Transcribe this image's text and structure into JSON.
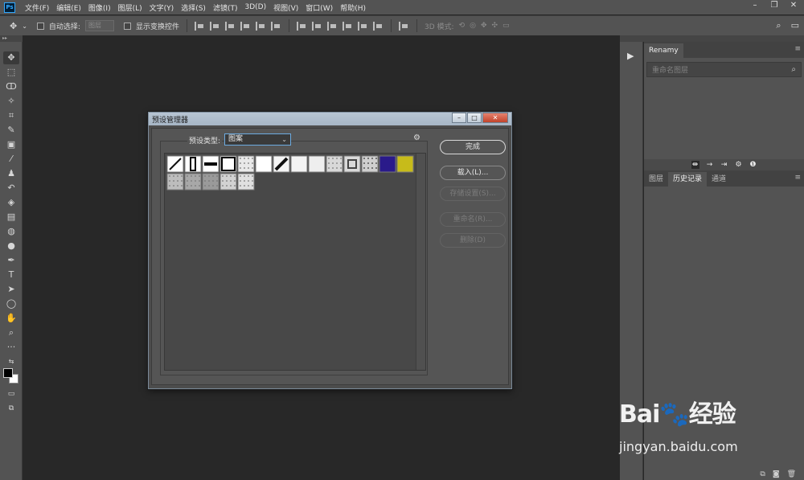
{
  "menubar": {
    "logo": "Ps",
    "items": [
      "文件(F)",
      "编辑(E)",
      "图像(I)",
      "图层(L)",
      "文字(Y)",
      "选择(S)",
      "滤镜(T)",
      "3D(D)",
      "视图(V)",
      "窗口(W)",
      "帮助(H)"
    ],
    "controls": {
      "minimize": "–",
      "restore": "❐",
      "close": "✕"
    }
  },
  "options": {
    "auto_select_label": "自动选择:",
    "auto_select_value": "图层",
    "show_transform_label": "显示变换控件",
    "mode_3d_label": "3D 模式:"
  },
  "panels": {
    "top_tab": "Renamy",
    "search_placeholder": "重命名图层",
    "bottom_tabs": [
      "图层",
      "历史记录",
      "通道"
    ]
  },
  "dialog": {
    "title": "预设管理器",
    "preset_type_label": "预设类型:",
    "preset_type_value": "图案",
    "buttons": {
      "done": "完成",
      "load": "载入(L)...",
      "save": "存储设置(S)...",
      "rename": "重命名(R)...",
      "delete": "删除(D)"
    },
    "pattern_count": 19
  },
  "watermark": {
    "logo_text": "Bai",
    "logo_text2": "经验",
    "url": "jingyan.baidu.com"
  },
  "colors": {
    "app_bg": "#282828",
    "panel_bg": "#535353",
    "dialog_title_bg": "#b3c1d0",
    "close_red": "#c8452d"
  }
}
